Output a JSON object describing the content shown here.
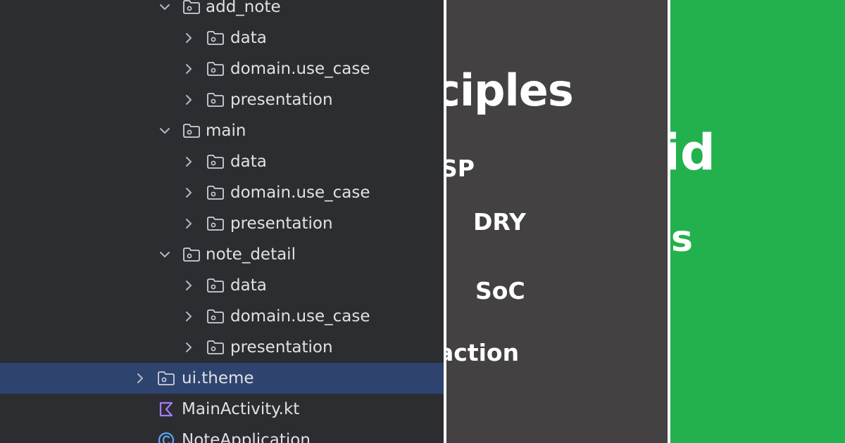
{
  "tree": [
    {
      "label": "add_note",
      "indent": 1,
      "expanded": true,
      "icon": "package-folder-icon",
      "selected": false
    },
    {
      "label": "data",
      "indent": 2,
      "expanded": false,
      "icon": "package-folder-icon",
      "selected": false
    },
    {
      "label": "domain.use_case",
      "indent": 2,
      "expanded": false,
      "icon": "package-folder-icon",
      "selected": false
    },
    {
      "label": "presentation",
      "indent": 2,
      "expanded": false,
      "icon": "package-folder-icon",
      "selected": false
    },
    {
      "label": "main",
      "indent": 1,
      "expanded": true,
      "icon": "package-folder-icon",
      "selected": false
    },
    {
      "label": "data",
      "indent": 2,
      "expanded": false,
      "icon": "package-folder-icon",
      "selected": false
    },
    {
      "label": "domain.use_case",
      "indent": 2,
      "expanded": false,
      "icon": "package-folder-icon",
      "selected": false
    },
    {
      "label": "presentation",
      "indent": 2,
      "expanded": false,
      "icon": "package-folder-icon",
      "selected": false
    },
    {
      "label": "note_detail",
      "indent": 1,
      "expanded": true,
      "icon": "package-folder-icon",
      "selected": false
    },
    {
      "label": "data",
      "indent": 2,
      "expanded": false,
      "icon": "package-folder-icon",
      "selected": false
    },
    {
      "label": "domain.use_case",
      "indent": 2,
      "expanded": false,
      "icon": "package-folder-icon",
      "selected": false
    },
    {
      "label": "presentation",
      "indent": 2,
      "expanded": false,
      "icon": "package-folder-icon",
      "selected": false
    },
    {
      "label": "ui.theme",
      "indent": 0,
      "expanded": false,
      "icon": "package-folder-icon",
      "selected": true
    },
    {
      "label": "MainActivity.kt",
      "indent": 0,
      "expanded": null,
      "icon": "kotlin-file-icon",
      "selected": false
    },
    {
      "label": "NoteApplication",
      "indent": 0,
      "expanded": null,
      "icon": "kotlin-class-icon",
      "selected": false
    }
  ],
  "principles": {
    "title": "nciples",
    "items": [
      "SP",
      "DRY",
      "SoC",
      "action"
    ]
  },
  "green": {
    "line1": "id",
    "line2": "s"
  },
  "colors": {
    "tree_bg": "#2b2d30",
    "selected_row": "#2e436e",
    "principles_bg": "#434142",
    "green_bg": "#23b14d",
    "separator": "#ffffff"
  }
}
